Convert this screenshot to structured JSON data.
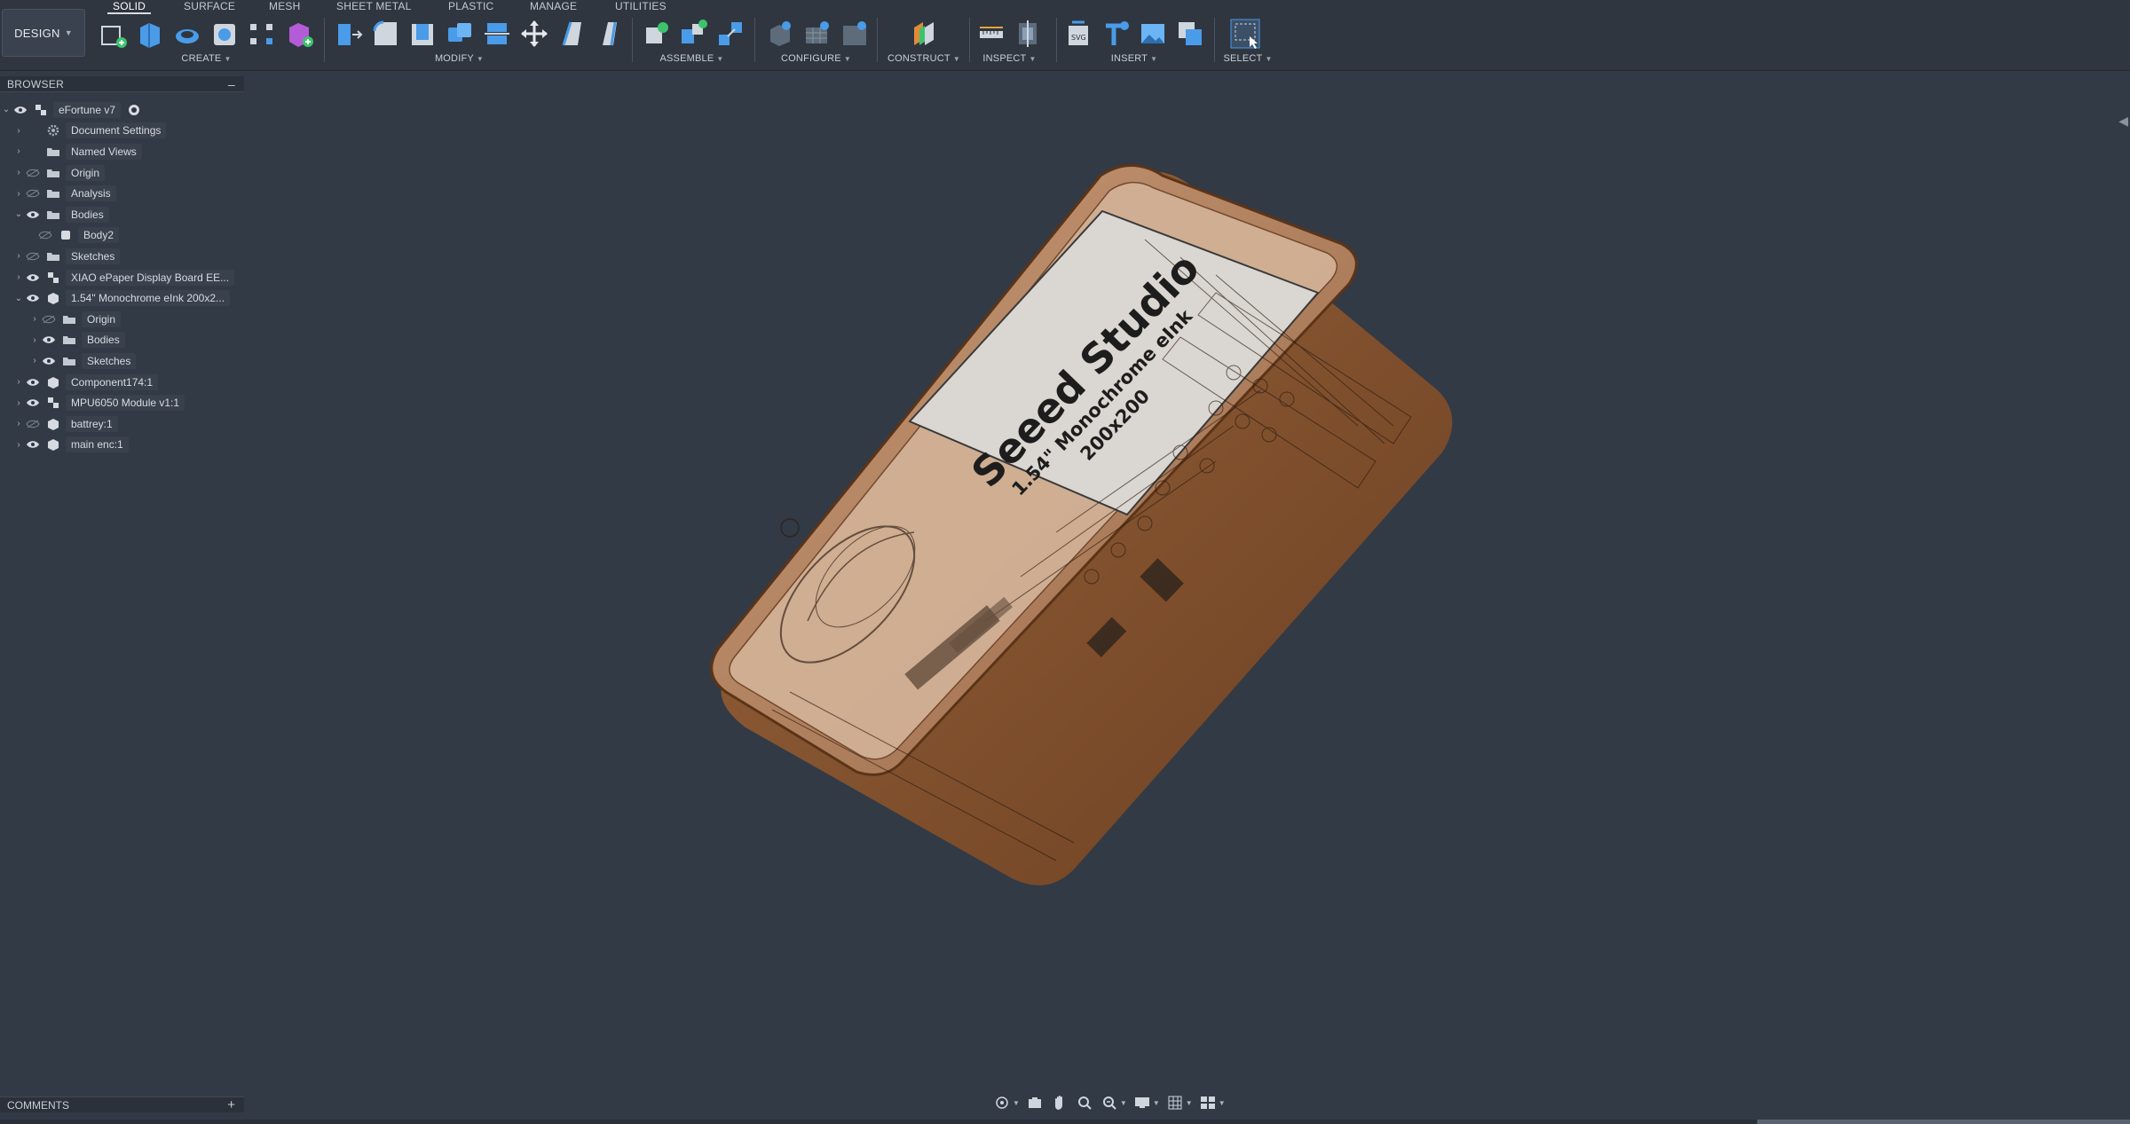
{
  "toolbar": {
    "workspace": "DESIGN",
    "tabs": [
      "SOLID",
      "SURFACE",
      "MESH",
      "SHEET METAL",
      "PLASTIC",
      "MANAGE",
      "UTILITIES"
    ],
    "active_tab": "SOLID",
    "groups": {
      "create": "CREATE",
      "modify": "MODIFY",
      "assemble": "ASSEMBLE",
      "configure": "CONFIGURE",
      "construct": "CONSTRUCT",
      "inspect": "INSPECT",
      "insert": "INSERT",
      "select": "SELECT"
    }
  },
  "browser": {
    "title": "BROWSER",
    "items": [
      {
        "label": "eFortune v7"
      },
      {
        "label": "Document Settings"
      },
      {
        "label": "Named Views"
      },
      {
        "label": "Origin"
      },
      {
        "label": "Analysis"
      },
      {
        "label": "Bodies"
      },
      {
        "label": "Body2"
      },
      {
        "label": "Sketches"
      },
      {
        "label": "XIAO ePaper Display Board EE..."
      },
      {
        "label": "1.54\" Monochrome eInk 200x2..."
      },
      {
        "label": "Origin"
      },
      {
        "label": "Bodies"
      },
      {
        "label": "Sketches"
      },
      {
        "label": "Component174:1"
      },
      {
        "label": "MPU6050 Module v1:1"
      },
      {
        "label": "battrey:1"
      },
      {
        "label": "main enc:1"
      }
    ]
  },
  "comments": {
    "title": "COMMENTS"
  },
  "model": {
    "brand": "Seeed Studio",
    "subtitle": "1.54\" Monochrome eInk",
    "resolution": "200x200",
    "body_color": "#8a5430",
    "screen_color": "#d9d4cf"
  },
  "colors": {
    "background": "#323a46",
    "toolbar": "#2f3640",
    "accent_blue": "#4a9be8"
  }
}
